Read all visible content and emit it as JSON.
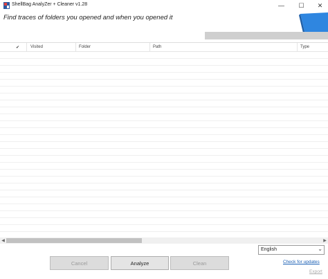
{
  "window": {
    "title": "ShellBag  AnalyZer + Cleaner v1.28",
    "controls": {
      "minimize": "—",
      "maximize": "☐",
      "close": "✕"
    }
  },
  "headline": "Find traces of folders you opened and when you opened it",
  "progress": {
    "value": 0
  },
  "grid": {
    "columns": {
      "check": "✔",
      "visited": "Visited",
      "folder": "Folder",
      "path": "Path",
      "type": "Type"
    },
    "rows": []
  },
  "language": {
    "selected": "English"
  },
  "buttons": {
    "cancel": "Cancel",
    "analyze": "Analyze",
    "clean": "Clean"
  },
  "links": {
    "updates": "Check for updates",
    "export": "Export"
  },
  "colors": {
    "accent_logo": "#2f86e0",
    "link": "#1a5fb4",
    "disabled_text": "#999999"
  },
  "icons": {
    "app": "shellbag-app-icon",
    "logo": "brand-logo-shape"
  }
}
